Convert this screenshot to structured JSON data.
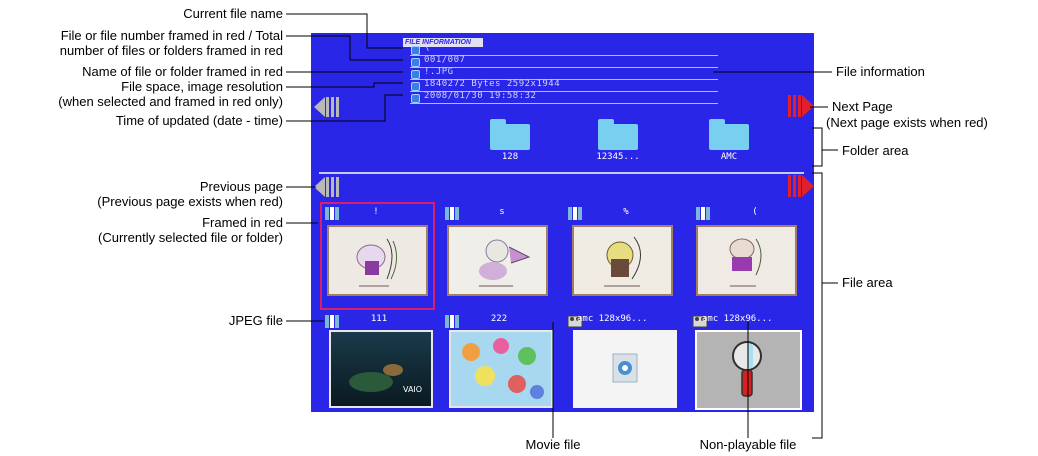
{
  "callouts": {
    "current_file_name": "Current file name",
    "file_number_line1": "File or file number framed in red / Total",
    "file_number_line2": "number of files or folders framed in red",
    "name_framed": "Name of file or folder framed in red",
    "file_space_line1": "File space, image resolution",
    "file_space_line2": "(when selected and framed in red only)",
    "time_updated": "Time of updated (date - time)",
    "previous_page_line1": "Previous page",
    "previous_page_line2": "(Previous page exists when red)",
    "framed_red_line1": "Framed in red",
    "framed_red_line2": "(Currently selected file or folder)",
    "jpeg_file": "JPEG file",
    "file_information": "File information",
    "next_page_line1": "Next Page",
    "next_page_line2": "(Next page exists when red)",
    "folder_area": "Folder area",
    "file_area": "File area",
    "movie_file": "Movie file",
    "non_playable_file": "Non-playable file"
  },
  "screen": {
    "header_tab": "FILE INFORMATION",
    "info_rows": [
      "\\",
      "001/007",
      "!.JPG",
      "1840272 Bytes  2592x1944",
      "2008/01/30  19:58:32"
    ],
    "folders": [
      "128",
      "12345...",
      "AMC"
    ],
    "files_row1": [
      "!",
      "s",
      "%",
      "("
    ],
    "files_row2": [
      "111",
      "222",
      "amc 128x96...",
      "amc 128x96..."
    ]
  },
  "colors": {
    "screen_bg": "#2a26e8",
    "selection_frame": "#d8206a",
    "arrow_active": "#e0202a",
    "arrow_inactive": "#b8b8b8"
  }
}
